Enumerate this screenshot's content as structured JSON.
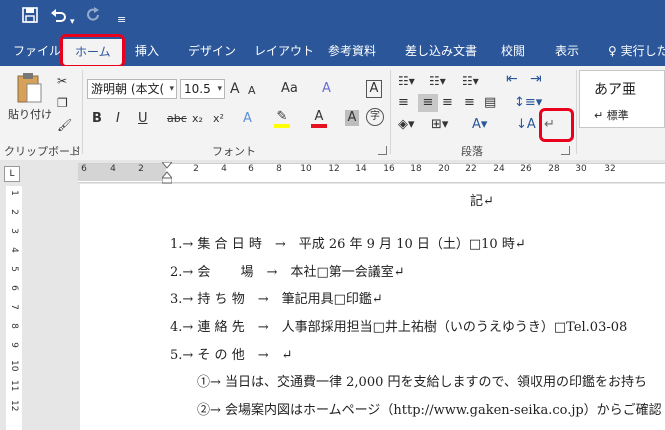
{
  "titlebar": {
    "save_icon": "save-icon",
    "undo_icon": "undo-icon",
    "redo_icon": "redo-icon",
    "customize_icon": "customize-qat-icon"
  },
  "tabs": [
    {
      "label": "ファイル"
    },
    {
      "label": "ホーム"
    },
    {
      "label": "挿入"
    },
    {
      "label": "デザイン"
    },
    {
      "label": "レイアウト"
    },
    {
      "label": "参考資料"
    },
    {
      "label": "差し込み文書"
    },
    {
      "label": "校閲"
    },
    {
      "label": "表示"
    },
    {
      "label": "実行した"
    }
  ],
  "ribbon": {
    "clipboard": {
      "paste_label": "貼り付け",
      "group_label": "クリップボード"
    },
    "font": {
      "name": "游明朝 (本文(",
      "size": "10.5",
      "group_label": "フォント",
      "bold": "B",
      "italic": "I",
      "underline": "U",
      "strike": "abc",
      "sub": "x₂",
      "sup": "x²",
      "grow": "A",
      "shrink": "A",
      "case": "Aa",
      "clear": "A",
      "char_border": "A",
      "char_shade": "A",
      "phonetic": "字"
    },
    "paragraph": {
      "group_label": "段落"
    },
    "styles": {
      "sample": "あア亜",
      "name": "↵ 標準"
    }
  },
  "ruler": {
    "h_ticks": [
      "6",
      "4",
      "2",
      "2",
      "4",
      "6",
      "8",
      "10",
      "12",
      "14",
      "16",
      "18",
      "20",
      "22",
      "24",
      "26",
      "28",
      "30",
      "32"
    ],
    "v_ticks": [
      "1",
      "2",
      "3",
      "4",
      "5",
      "6",
      "7",
      "8",
      "9",
      "10",
      "11",
      "12"
    ]
  },
  "document": {
    "heading": "記↵",
    "lines": [
      "1.→ 集 合 日 時　→　平成 26 年 9 月 10 日（土）□10 時↵",
      "2.→ 会　　 場　→　本社□第一会議室↵",
      "3.→ 持 ち 物　→　筆記用具□印鑑↵",
      "4.→ 連 絡 先　→　人事部採用担当□井上祐樹（いのうえゆうき）□Tel.03-08",
      "5.→ そ の 他　→　↵",
      "①→ 当日は、交通費一律 2,000 円を支給しますので、領収用の印鑑をお持ち",
      "②→ 会場案内図はホームページ（http://www.gaken-seika.co.jp）からご確認"
    ]
  }
}
